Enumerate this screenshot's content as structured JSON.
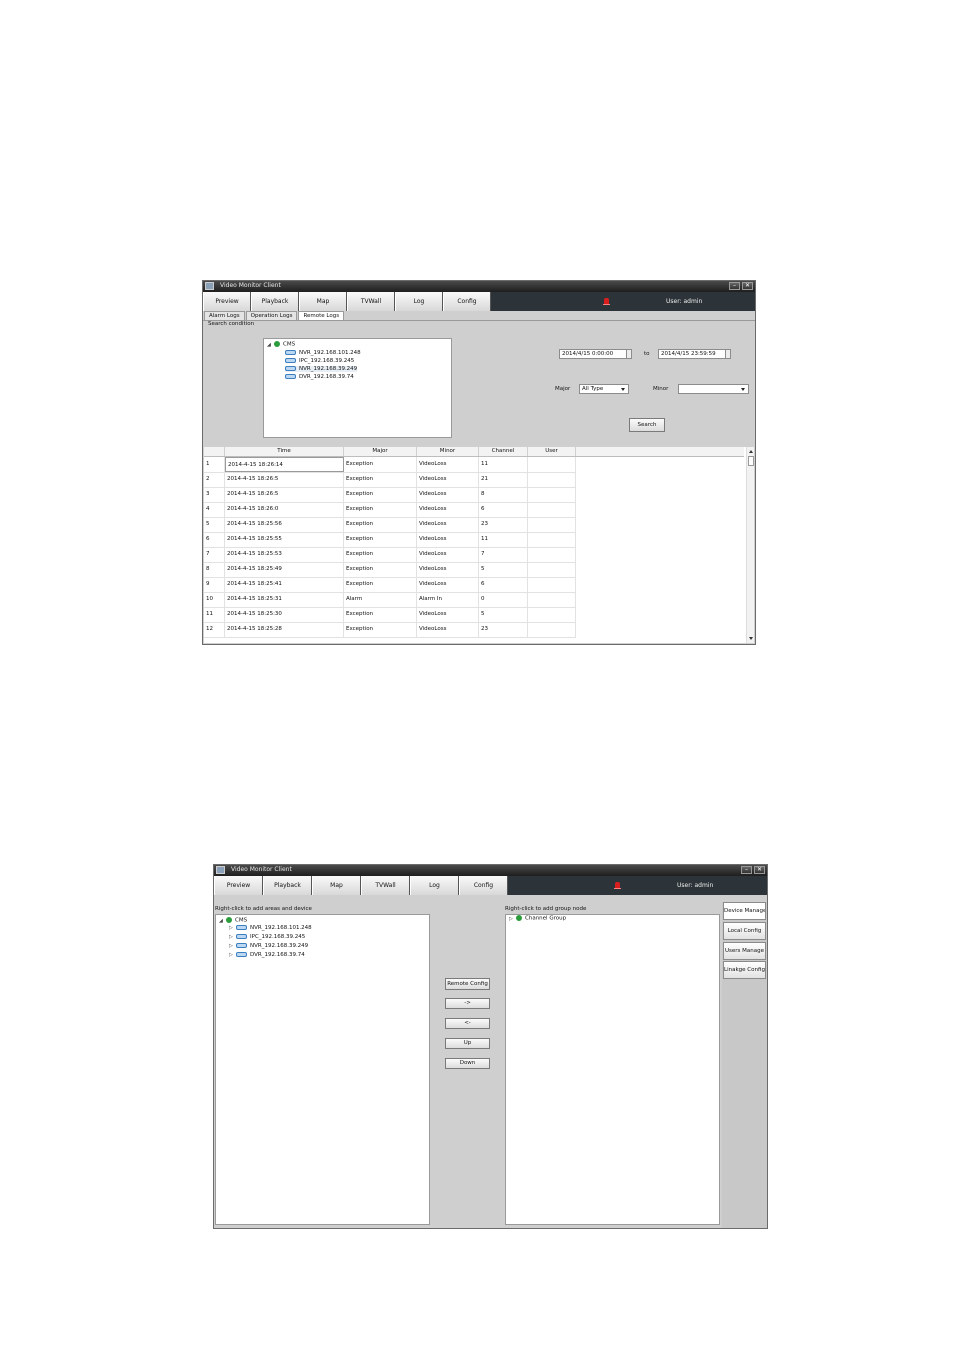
{
  "window1": {
    "title": "Video Monitor Client",
    "controls": {
      "minimize": "–",
      "close": "✕"
    },
    "nav_tabs": [
      "Preview",
      "Playback",
      "Map",
      "TVWall",
      "Log",
      "Config"
    ],
    "user_label": "User: admin",
    "sub_tabs": [
      "Alarm Logs",
      "Operation Logs",
      "Remote Logs"
    ],
    "active_sub_tab": "Remote Logs",
    "search_condition_label": "Search condition",
    "tree": {
      "root": "CMS",
      "devices": [
        "NVR_192.168.101.248",
        "IPC_192.168.39.245",
        "NVR_192.168.39.249",
        "DVR_192.168.39.74"
      ]
    },
    "date_from": "2014/4/15 0:00:00",
    "to_label": "to",
    "date_to": "2014/4/15 23:59:59",
    "major_label": "Major",
    "major_value": "All Type",
    "minor_label": "Minor",
    "minor_value": "",
    "search_button": "Search",
    "table": {
      "columns": [
        "Time",
        "Major",
        "Minor",
        "Channel",
        "User"
      ],
      "rows": [
        [
          "1",
          "2014-4-15 18:26:14",
          "Exception",
          "VideoLoss",
          "11",
          ""
        ],
        [
          "2",
          "2014-4-15 18:26:5",
          "Exception",
          "VideoLoss",
          "21",
          ""
        ],
        [
          "3",
          "2014-4-15 18:26:5",
          "Exception",
          "VideoLoss",
          "8",
          ""
        ],
        [
          "4",
          "2014-4-15 18:26:0",
          "Exception",
          "VideoLoss",
          "6",
          ""
        ],
        [
          "5",
          "2014-4-15 18:25:56",
          "Exception",
          "VideoLoss",
          "23",
          ""
        ],
        [
          "6",
          "2014-4-15 18:25:55",
          "Exception",
          "VideoLoss",
          "11",
          ""
        ],
        [
          "7",
          "2014-4-15 18:25:53",
          "Exception",
          "VideoLoss",
          "7",
          ""
        ],
        [
          "8",
          "2014-4-15 18:25:49",
          "Exception",
          "VideoLoss",
          "5",
          ""
        ],
        [
          "9",
          "2014-4-15 18:25:41",
          "Exception",
          "VideoLoss",
          "6",
          ""
        ],
        [
          "10",
          "2014-4-15 18:25:31",
          "Alarm",
          "Alarm In",
          "0",
          ""
        ],
        [
          "11",
          "2014-4-15 18:25:30",
          "Exception",
          "VideoLoss",
          "5",
          ""
        ],
        [
          "12",
          "2014-4-15 18:25:28",
          "Exception",
          "VideoLoss",
          "23",
          ""
        ]
      ]
    }
  },
  "window2": {
    "title": "Video Monitor Client",
    "controls": {
      "minimize": "–",
      "close": "✕"
    },
    "nav_tabs": [
      "Preview",
      "Playback",
      "Map",
      "TVWall",
      "Log",
      "Config"
    ],
    "user_label": "User: admin",
    "left_hint": "Right-click to add areas and device",
    "right_hint": "Right-click to add group node",
    "tree": {
      "root": "CMS",
      "devices": [
        "NVR_192.168.101.248",
        "IPC_192.168.39.245",
        "NVR_192.168.39.249",
        "DVR_192.168.39.74"
      ]
    },
    "channel_group": "Channel Group",
    "middle_buttons": [
      "Remote Config",
      "->",
      "<-",
      "Up",
      "Down"
    ],
    "side_buttons": [
      "Device Manage",
      "Local Config",
      "Users Manage",
      "Linakge Config"
    ]
  },
  "colors": {
    "title_bar": "#1e1e1e",
    "nav_bar": "#2c3439",
    "panel_bg": "#cfcfcf",
    "alarm": "#d91e1e"
  }
}
